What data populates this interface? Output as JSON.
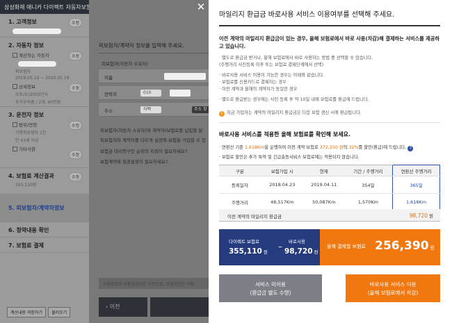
{
  "background": {
    "header_title": "삼성화재 애니카 다이렉트 자동차보험",
    "sidebar": {
      "sections": [
        {
          "title": "1. 고객정보",
          "edit": "수정"
        },
        {
          "title": "2. 자동차 정보",
          "items": [
            {
              "label": "계산하는 자동차",
              "edit": "수정"
            },
            {
              "label": "피보험자",
              "edit": ""
            },
            {
              "label": "2019.05.19 ~ 2020.05.19",
              "edit": ""
            },
            {
              "label": "상세정보",
              "edit": "수정"
            },
            {
              "label": "오토/도/2003년식",
              "edit": ""
            },
            {
              "label": "추가부속품 / 2개, 60만원",
              "edit": ""
            }
          ]
        },
        {
          "title": "3. 운전자 정보",
          "items": [
            {
              "label": "범위/연령",
              "edit": "수정"
            },
            {
              "label": "기명피보험자 1인",
              "edit": ""
            },
            {
              "label": "만 43세 이상",
              "edit": ""
            },
            {
              "label": "기타사항",
              "edit": "수정"
            }
          ]
        },
        {
          "title": "4. 보험료 계산결과",
          "edit": "수정",
          "value": "355,110원"
        },
        {
          "title": "5. 피보험자/계약자정보"
        },
        {
          "title": "6. 청약내용 확인"
        },
        {
          "title": "7. 보험료 결제"
        }
      ],
      "bottom_buttons": [
        "계산내용 저장하기",
        "불러오기"
      ]
    },
    "main": {
      "title": "피보험자/계약자 정보를 입력해 주세요.",
      "label_insured": "피보험자(자동차 소유자)",
      "row_name": "이름",
      "row_contact": "연락처",
      "phone_prefix": "010",
      "row_address": "주소",
      "addr_home": "자택",
      "addr_search": "주소 찾",
      "q1": "피보험자(자동차 소유자)와 계약자(보험료를 납입할 분",
      "q2": "피보험자와 계약자를 다르게 설정해 보험을 가입할 수 있",
      "q3": "보험금 대리청구인 순위의 지정이 필요하세요?",
      "q4": "보험계약에 질권설정이 필요하세요?",
      "notice": "보험증권과 상품설명서는 우편으로, 보험약관은 이메",
      "prev_button": "이전"
    }
  },
  "modal": {
    "title": "마일리지 환급금 바로사용 서비스 이용여부를 선택해 주세요.",
    "intro": "이전 계약의 마일리지 환급금이 있는 경우, 올해 보험료에서 바로 사용(차감)해 결제하는 서비스를 제공하고 있습니다.",
    "bullets": [
      "· 별도로 환급금 받거나, 올해 보험료에서 바로 사용하는 방법 중 선택할 수 있습니다.",
      "  (주행거리 사진등록 이후 또는 보험료 결제단계에서 선택)",
      "· 바로사용 서비스 이용이 가능한 경우는 아래와 같습니다.",
      "  · 보험료를 신용카드로 결제하는 경우",
      "  · 이전 계약과 올해의 계약자가 동일한 경우",
      "· 별도로 환급받는 경우에는 사진 등록 후 약 10일 내에 보험료를 환급해 드립니다."
    ],
    "warning": "지금 가입하는 계약의 마일리지 환급금은 다음 보험 갱신 시에 환급됩니다.",
    "section_title": "바로사용 서비스를 적용한 올해 보험료를 확인해 보세요.",
    "info_line_parts": [
      "· 연환산 기준 ",
      "1,618Km",
      "을 운행하여 이전 계약 보험료 ",
      "372,250 원",
      "의 ",
      "32%",
      "를 할인(환급)해 드립니다."
    ],
    "info_line2": "· 보험료 할인은 추가 특약 및 긴급출동서비스 보험료에는 적용되지 않습니다.",
    "table": {
      "headers": [
        "구분",
        "보험가입 시",
        "현재",
        "기간 / 주행거리",
        "연환산 주행거리"
      ],
      "rows": [
        [
          "등록일자",
          "2018.04.23",
          "2019.04.11",
          "354일",
          "365일"
        ],
        [
          "주행거리",
          "48,517Km",
          "50,087Km",
          "1,570Km",
          "1,618Km"
        ]
      ]
    },
    "refund_label": "이전 계약의 마일리지 환급금",
    "refund_value": "98,720",
    "refund_unit": "원",
    "summary": {
      "direct_label": "다이렉트 보험료",
      "direct_value": "355,110",
      "use_label": "바로사용",
      "use_value": "98,720",
      "unit": "원",
      "final_label": "올해 결제할 보험료",
      "final_value": "256,390"
    },
    "btn_not_use_line1": "서비스 미이용",
    "btn_not_use_line2": "(환급금 별도 수령)",
    "btn_use_line1": "바로사용 서비스 이용",
    "btn_use_line2": "(올해 보험료에서 차감)"
  },
  "colors": {
    "accent_blue": "#263b7e",
    "accent_orange": "#f0780e",
    "gray_button": "#7c7f86"
  }
}
